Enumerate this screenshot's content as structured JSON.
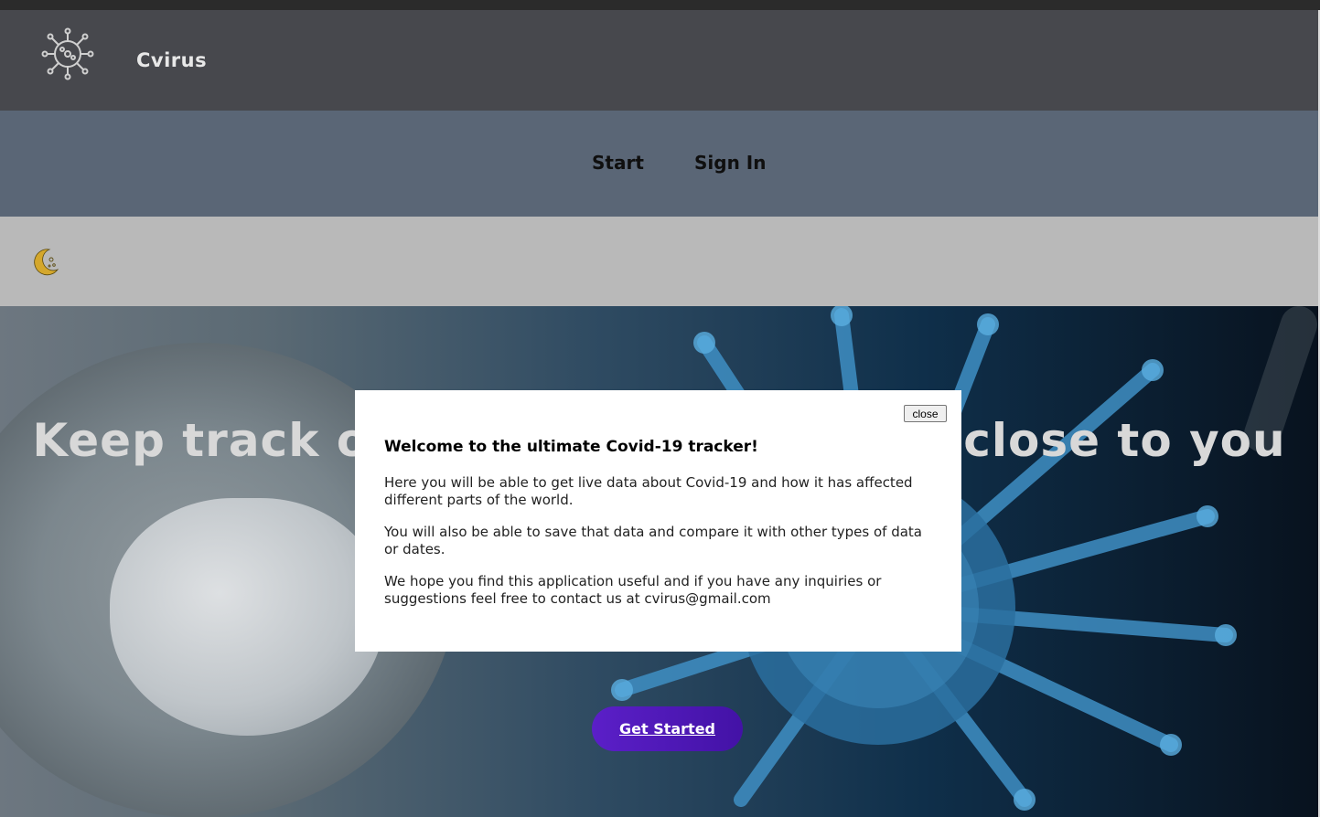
{
  "header": {
    "brand": "Cvirus",
    "logo_icon": "virus-icon"
  },
  "nav": {
    "items": [
      {
        "label": "Start"
      },
      {
        "label": "Sign In"
      }
    ]
  },
  "theme_toggle": {
    "icon": "moon-icon"
  },
  "hero": {
    "title_left": "Keep track o",
    "title_right": "close to you",
    "cta_label": "Get Started"
  },
  "modal": {
    "close_label": "close",
    "title": "Welcome to the ultimate Covid-19 tracker!",
    "paragraphs": [
      "Here you will be able to get live data about Covid-19 and how it has affected different parts of the world.",
      "You will also be able to save that data and compare it with other types of data or dates.",
      "We hope you find this application useful and if you have any inquiries or suggestions feel free to contact us at cvirus@gmail.com"
    ]
  },
  "colors": {
    "header_bg": "#47484d",
    "nav_bg": "#5a6676",
    "theme_bar_bg": "#b9b9b9",
    "cta_bg": "#5b1fc8",
    "moon_color": "#d4a72c"
  }
}
